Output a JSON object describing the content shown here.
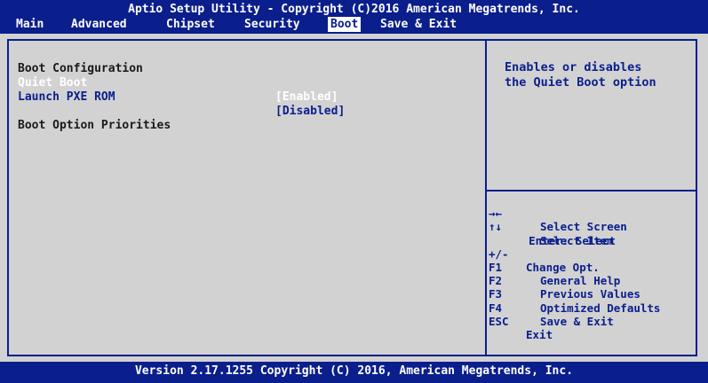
{
  "header": {
    "title": "Aptio Setup Utility - Copyright (C)2016 American Megatrends, Inc.",
    "tabs": [
      {
        "label": "Main",
        "active": false
      },
      {
        "label": "Advanced",
        "active": false
      },
      {
        "label": "Chipset",
        "active": false
      },
      {
        "label": "Security",
        "active": false
      },
      {
        "label": "Boot",
        "active": true
      },
      {
        "label": "Save & Exit",
        "active": false
      }
    ]
  },
  "left_panel": {
    "section_title": "Boot Configuration",
    "items": [
      {
        "label": "Quiet Boot",
        "value": "[Enabled]",
        "selected": true
      },
      {
        "label": "Launch PXE ROM",
        "value": "[Disabled]",
        "selected": false
      }
    ],
    "priorities_title": "Boot Option Priorities"
  },
  "help_panel": {
    "line1": "Enables or disables",
    "line2": "the Quiet Boot option"
  },
  "key_help": [
    {
      "key": "→←",
      "desc": "Select Screen"
    },
    {
      "key": "↑↓",
      "desc": "Select Item"
    },
    {
      "key": "Enter: Select",
      "desc": ""
    },
    {
      "key": "+/-",
      "desc": "Change Opt."
    },
    {
      "key": "F1",
      "desc": "General Help"
    },
    {
      "key": "F2",
      "desc": "Previous Values"
    },
    {
      "key": "F3",
      "desc": "Optimized Defaults"
    },
    {
      "key": "F4",
      "desc": "Save & Exit"
    },
    {
      "key": "ESC",
      "desc": "Exit"
    }
  ],
  "footer": {
    "text": "Version 2.17.1255 Copyright (C) 2016, American Megatrends, Inc."
  },
  "colors": {
    "bios_blue": "#0a1e8c",
    "panel_gray": "#d2d2d2",
    "selected_text": "#ffffff"
  }
}
